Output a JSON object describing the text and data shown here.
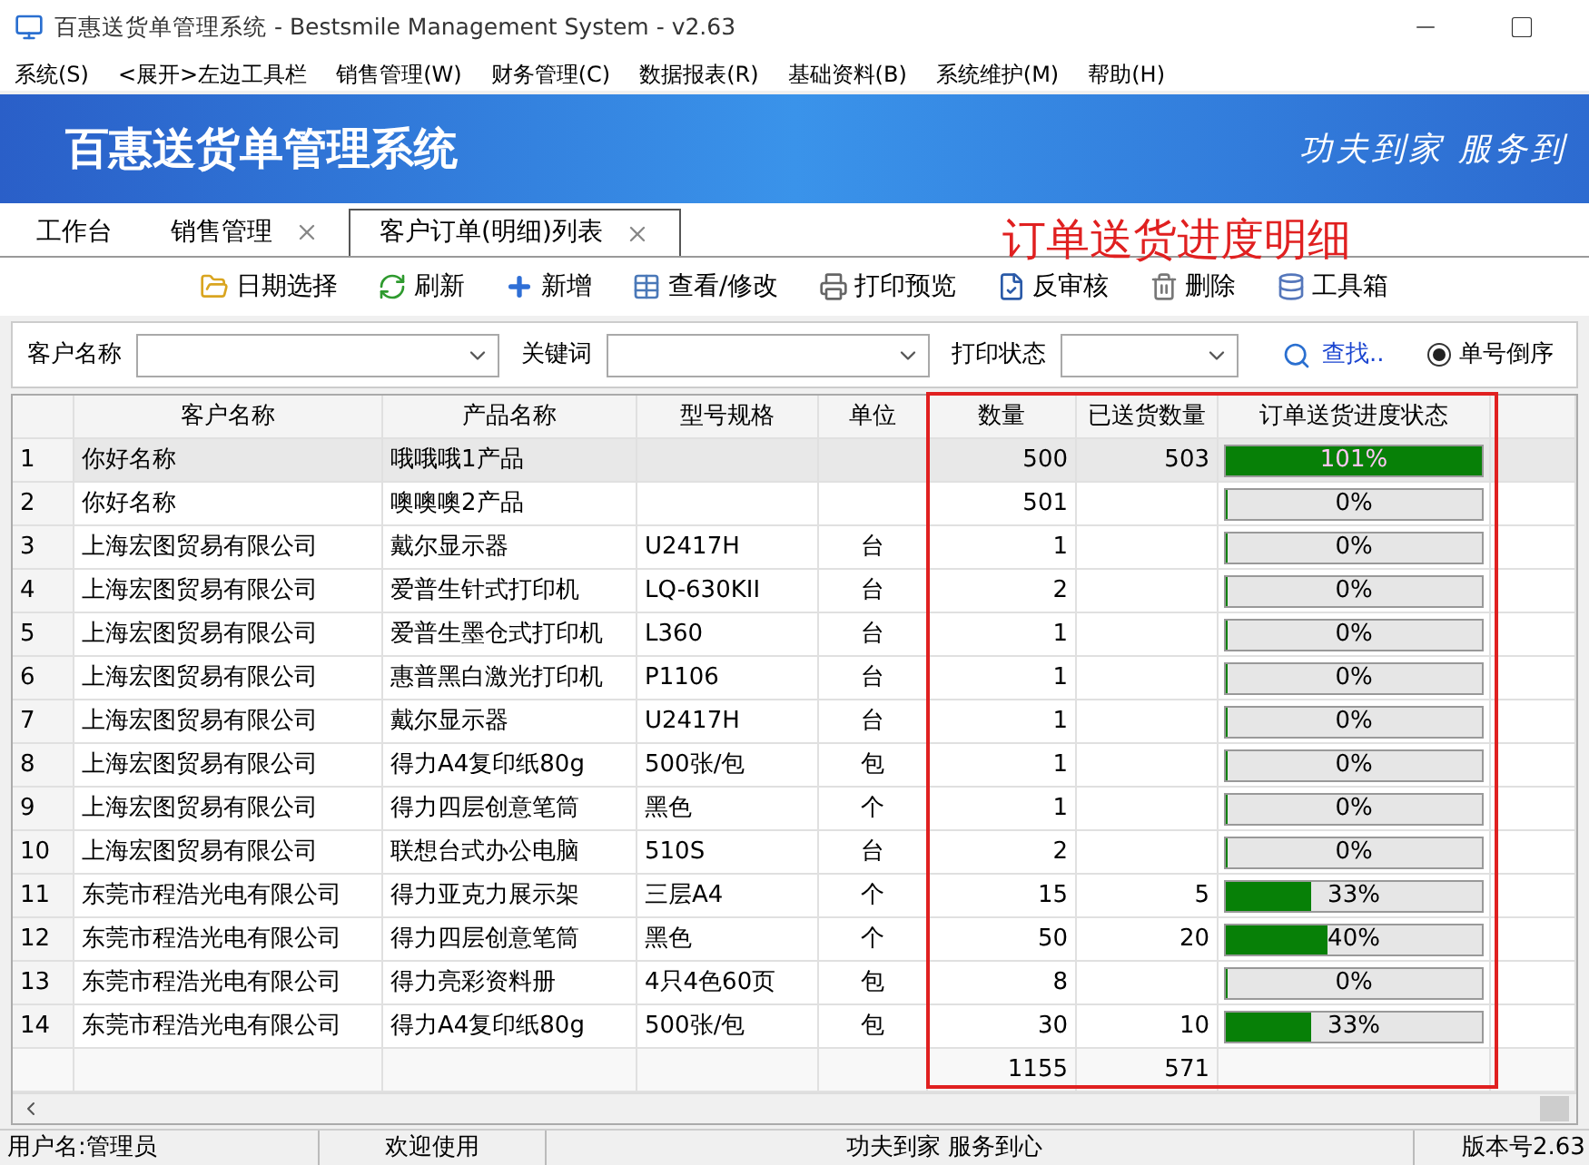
{
  "window": {
    "title": "百惠送货单管理系统 - Bestsmile Management System - v2.63"
  },
  "menu": [
    "系统(S)",
    "<展开>左边工具栏",
    "销售管理(W)",
    "财务管理(C)",
    "数据报表(R)",
    "基础资料(B)",
    "系统维护(M)",
    "帮助(H)"
  ],
  "banner": {
    "title": "百惠送货单管理系统",
    "slogan": "功夫到家 服务到"
  },
  "tabs": [
    {
      "label": "工作台",
      "selected": false,
      "closable": false
    },
    {
      "label": "销售管理",
      "selected": false,
      "closable": true
    },
    {
      "label": "客户订单(明细)列表",
      "selected": true,
      "closable": true
    }
  ],
  "page_heading": "订单送货进度明细",
  "toolbar": [
    {
      "label": "日期选择",
      "kind": "date"
    },
    {
      "label": "刷新",
      "kind": "refresh"
    },
    {
      "label": "新增",
      "kind": "add"
    },
    {
      "label": "查看/修改",
      "kind": "view"
    },
    {
      "label": "打印预览",
      "kind": "print"
    },
    {
      "label": "反审核",
      "kind": "unaudit"
    },
    {
      "label": "删除",
      "kind": "delete"
    },
    {
      "label": "工具箱",
      "kind": "tools"
    }
  ],
  "filters": {
    "customer_label": "客户名称",
    "keyword_label": "关键词",
    "print_label": "打印状态",
    "search": "查找..",
    "sort": {
      "label": "单号倒序",
      "selected": true
    }
  },
  "table": {
    "columns": [
      "客户名称",
      "产品名称",
      "型号规格",
      "单位",
      "数量",
      "已送货数量",
      "订单送货进度状态"
    ],
    "rows": [
      {
        "no": "1",
        "customer": "你好名称",
        "product": "哦哦哦1产品",
        "model": "",
        "unit": "",
        "qty": "500",
        "delivered": "503",
        "progress": "101%",
        "level": 1,
        "selected": true
      },
      {
        "no": "2",
        "customer": "你好名称",
        "product": "噢噢噢2产品",
        "model": "",
        "unit": "",
        "qty": "501",
        "delivered": "",
        "progress": "0%",
        "level": 0,
        "selected": false
      },
      {
        "no": "3",
        "customer": "上海宏图贸易有限公司",
        "product": "戴尔显示器",
        "model": "U2417H",
        "unit": "台",
        "qty": "1",
        "delivered": "",
        "progress": "0%",
        "level": 0,
        "selected": false
      },
      {
        "no": "4",
        "customer": "上海宏图贸易有限公司",
        "product": "爱普生针式打印机",
        "model": "LQ-630KII",
        "unit": "台",
        "qty": "2",
        "delivered": "",
        "progress": "0%",
        "level": 0,
        "selected": false
      },
      {
        "no": "5",
        "customer": "上海宏图贸易有限公司",
        "product": "爱普生墨仓式打印机",
        "model": "L360",
        "unit": "台",
        "qty": "1",
        "delivered": "",
        "progress": "0%",
        "level": 0,
        "selected": false
      },
      {
        "no": "6",
        "customer": "上海宏图贸易有限公司",
        "product": "惠普黑白激光打印机",
        "model": "P1106",
        "unit": "台",
        "qty": "1",
        "delivered": "",
        "progress": "0%",
        "level": 0,
        "selected": false
      },
      {
        "no": "7",
        "customer": "上海宏图贸易有限公司",
        "product": "戴尔显示器",
        "model": "U2417H",
        "unit": "台",
        "qty": "1",
        "delivered": "",
        "progress": "0%",
        "level": 0,
        "selected": false
      },
      {
        "no": "8",
        "customer": "上海宏图贸易有限公司",
        "product": "得力A4复印纸80g",
        "model": "500张/包",
        "unit": "包",
        "qty": "1",
        "delivered": "",
        "progress": "0%",
        "level": 0,
        "selected": false
      },
      {
        "no": "9",
        "customer": "上海宏图贸易有限公司",
        "product": "得力四层创意笔筒",
        "model": "黑色",
        "unit": "个",
        "qty": "1",
        "delivered": "",
        "progress": "0%",
        "level": 0,
        "selected": false
      },
      {
        "no": "10",
        "customer": "上海宏图贸易有限公司",
        "product": "联想台式办公电脑",
        "model": "510S",
        "unit": "台",
        "qty": "2",
        "delivered": "",
        "progress": "0%",
        "level": 0,
        "selected": false
      },
      {
        "no": "11",
        "customer": "东莞市程浩光电有限公司",
        "product": "得力亚克力展示架",
        "model": "三层A4",
        "unit": "个",
        "qty": "15",
        "delivered": "5",
        "progress": "33%",
        "level": 0.33,
        "selected": false
      },
      {
        "no": "12",
        "customer": "东莞市程浩光电有限公司",
        "product": "得力四层创意笔筒",
        "model": "黑色",
        "unit": "个",
        "qty": "50",
        "delivered": "20",
        "progress": "40%",
        "level": 0.4,
        "selected": false
      },
      {
        "no": "13",
        "customer": "东莞市程浩光电有限公司",
        "product": "得力亮彩资料册",
        "model": "4只4色60页",
        "unit": "包",
        "qty": "8",
        "delivered": "",
        "progress": "0%",
        "level": 0,
        "selected": false
      },
      {
        "no": "14",
        "customer": "东莞市程浩光电有限公司",
        "product": "得力A4复印纸80g",
        "model": "500张/包",
        "unit": "包",
        "qty": "30",
        "delivered": "10",
        "progress": "33%",
        "level": 0.33,
        "selected": false
      }
    ],
    "totals": {
      "qty": "1155",
      "delivered": "571"
    }
  },
  "status_bar": [
    "用户名:管理员",
    "欢迎使用",
    "功夫到家 服务到心",
    "版本号2.63"
  ]
}
